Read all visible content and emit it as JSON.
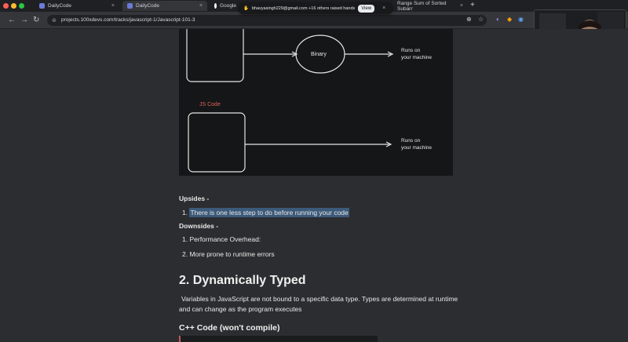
{
  "tabs": [
    {
      "title": "DailyCode"
    },
    {
      "title": "DailyCode"
    },
    {
      "title": "Google"
    },
    {
      "title": "Range Sum of Sorted Subarr"
    }
  ],
  "address": {
    "url": "projects.100xdevs.com/tracks/javascript-1/Javascript-101-3"
  },
  "notification": {
    "text": "bhavyasingh229@gmail.com +16 others raised hands",
    "button": "View"
  },
  "diagram": {
    "binary_label": "Binary",
    "runs_label_1": "Runs on",
    "runs_label_2": "your machine",
    "runs_label_3": "Runs on",
    "runs_label_4": "your machine",
    "js_code_label": "JS Code"
  },
  "article": {
    "upsides_heading": "Upsides -",
    "upside_1_num": "1.",
    "upside_1": "There is one less step to do before running your code",
    "downsides_heading": "Downsides -",
    "downside_1_num": "1.",
    "downside_1": "Performance Overhead:",
    "downside_2_num": "2.",
    "downside_2": "More prone to runtime errors",
    "section_heading": "2. Dynamically Typed",
    "section_text_1": "Variables in JavaScript are not bound to a specific data type. Types are determined at runtime",
    "section_text_2": "and can change as the program executes",
    "subheading": "C++ Code (won't compile)"
  },
  "colors": {
    "accent": "#3c5a7a",
    "js_label": "#e0645a"
  }
}
